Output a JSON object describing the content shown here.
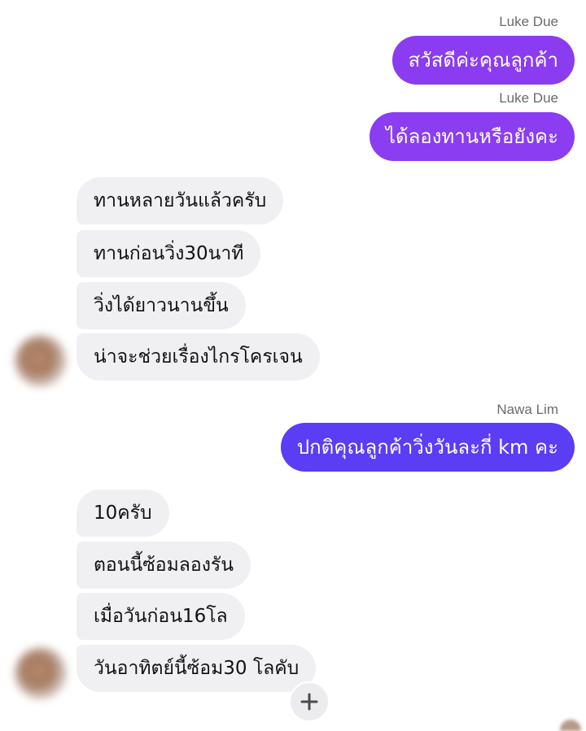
{
  "colors": {
    "outgoing_bubble_violet": "#8b3cf0",
    "outgoing_bubble_indigo": "#5a3df5",
    "incoming_bubble": "#f0f0f2",
    "sender_name": "#6a6a6e"
  },
  "messages": {
    "sender_1": "Luke Due",
    "out_1": "สวัสดีค่ะคุณลูกค้า",
    "sender_2": "Luke Due",
    "out_2": "ได้ลองทานหรือยังคะ",
    "in_1": "ทานหลายวันแล้วครับ",
    "in_2": "ทานก่อนวิ่ง30นาที",
    "in_3": "วิ่งได้ยาวนานขึ้น",
    "in_4": "น่าจะช่วยเรื่องไกรโครเจน",
    "sender_3": "Nawa Lim",
    "out_3": "ปกติคุณลูกค้าวิ่งวันละกี่ km คะ",
    "in_5": "10ครับ",
    "in_6": "ตอนนี้ซ้อมลองรัน",
    "in_7": "เมื่อวันก่อน16โล",
    "in_8": "วันอาทิตย์นี้ซ้อม30 โลคับ"
  },
  "icons": {
    "add_reaction": "plus-icon",
    "avatar": "blurred-avatar"
  }
}
